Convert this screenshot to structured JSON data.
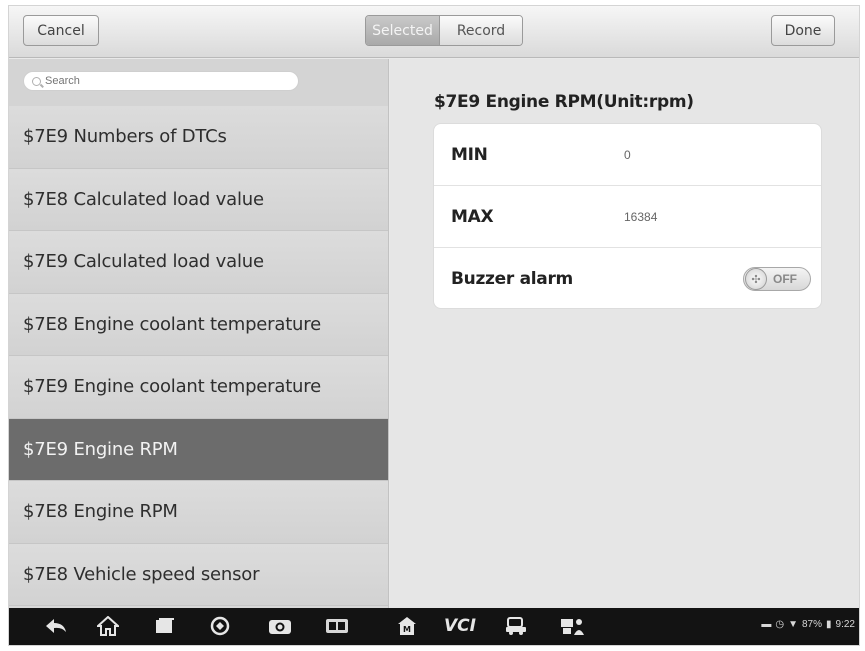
{
  "toolbar": {
    "cancel_label": "Cancel",
    "tabs": [
      {
        "label": "Selected",
        "active": true
      },
      {
        "label": "Record",
        "active": false
      }
    ],
    "done_label": "Done"
  },
  "search": {
    "placeholder": "Search"
  },
  "list": {
    "items": [
      {
        "label": "$7E9 Numbers of DTCs"
      },
      {
        "label": "$7E8 Calculated load value"
      },
      {
        "label": "$7E9 Calculated load value"
      },
      {
        "label": "$7E8 Engine coolant temperature"
      },
      {
        "label": "$7E9 Engine coolant temperature"
      },
      {
        "label": "$7E9 Engine RPM"
      },
      {
        "label": "$7E8 Engine RPM"
      },
      {
        "label": "$7E8 Vehicle speed sensor"
      }
    ],
    "selected_index": 5
  },
  "detail": {
    "title": "$7E9 Engine RPM(Unit:rpm)",
    "min_label": "MIN",
    "min_value": "0",
    "max_label": "MAX",
    "max_value": "16384",
    "buzzer_label": "Buzzer alarm",
    "buzzer_state": "OFF"
  },
  "navbar": {
    "icons": [
      "back-icon",
      "home-icon",
      "recent-apps-icon",
      "browser-icon",
      "camera-icon",
      "display-icon",
      "maxifix-icon",
      "vci-icon",
      "car-icon",
      "remote-support-icon"
    ],
    "vci_label": "VCI",
    "battery": "87%",
    "time": "9:22"
  },
  "colors": {
    "selected_row": "#6c6c6c",
    "navbar": "#131313"
  }
}
